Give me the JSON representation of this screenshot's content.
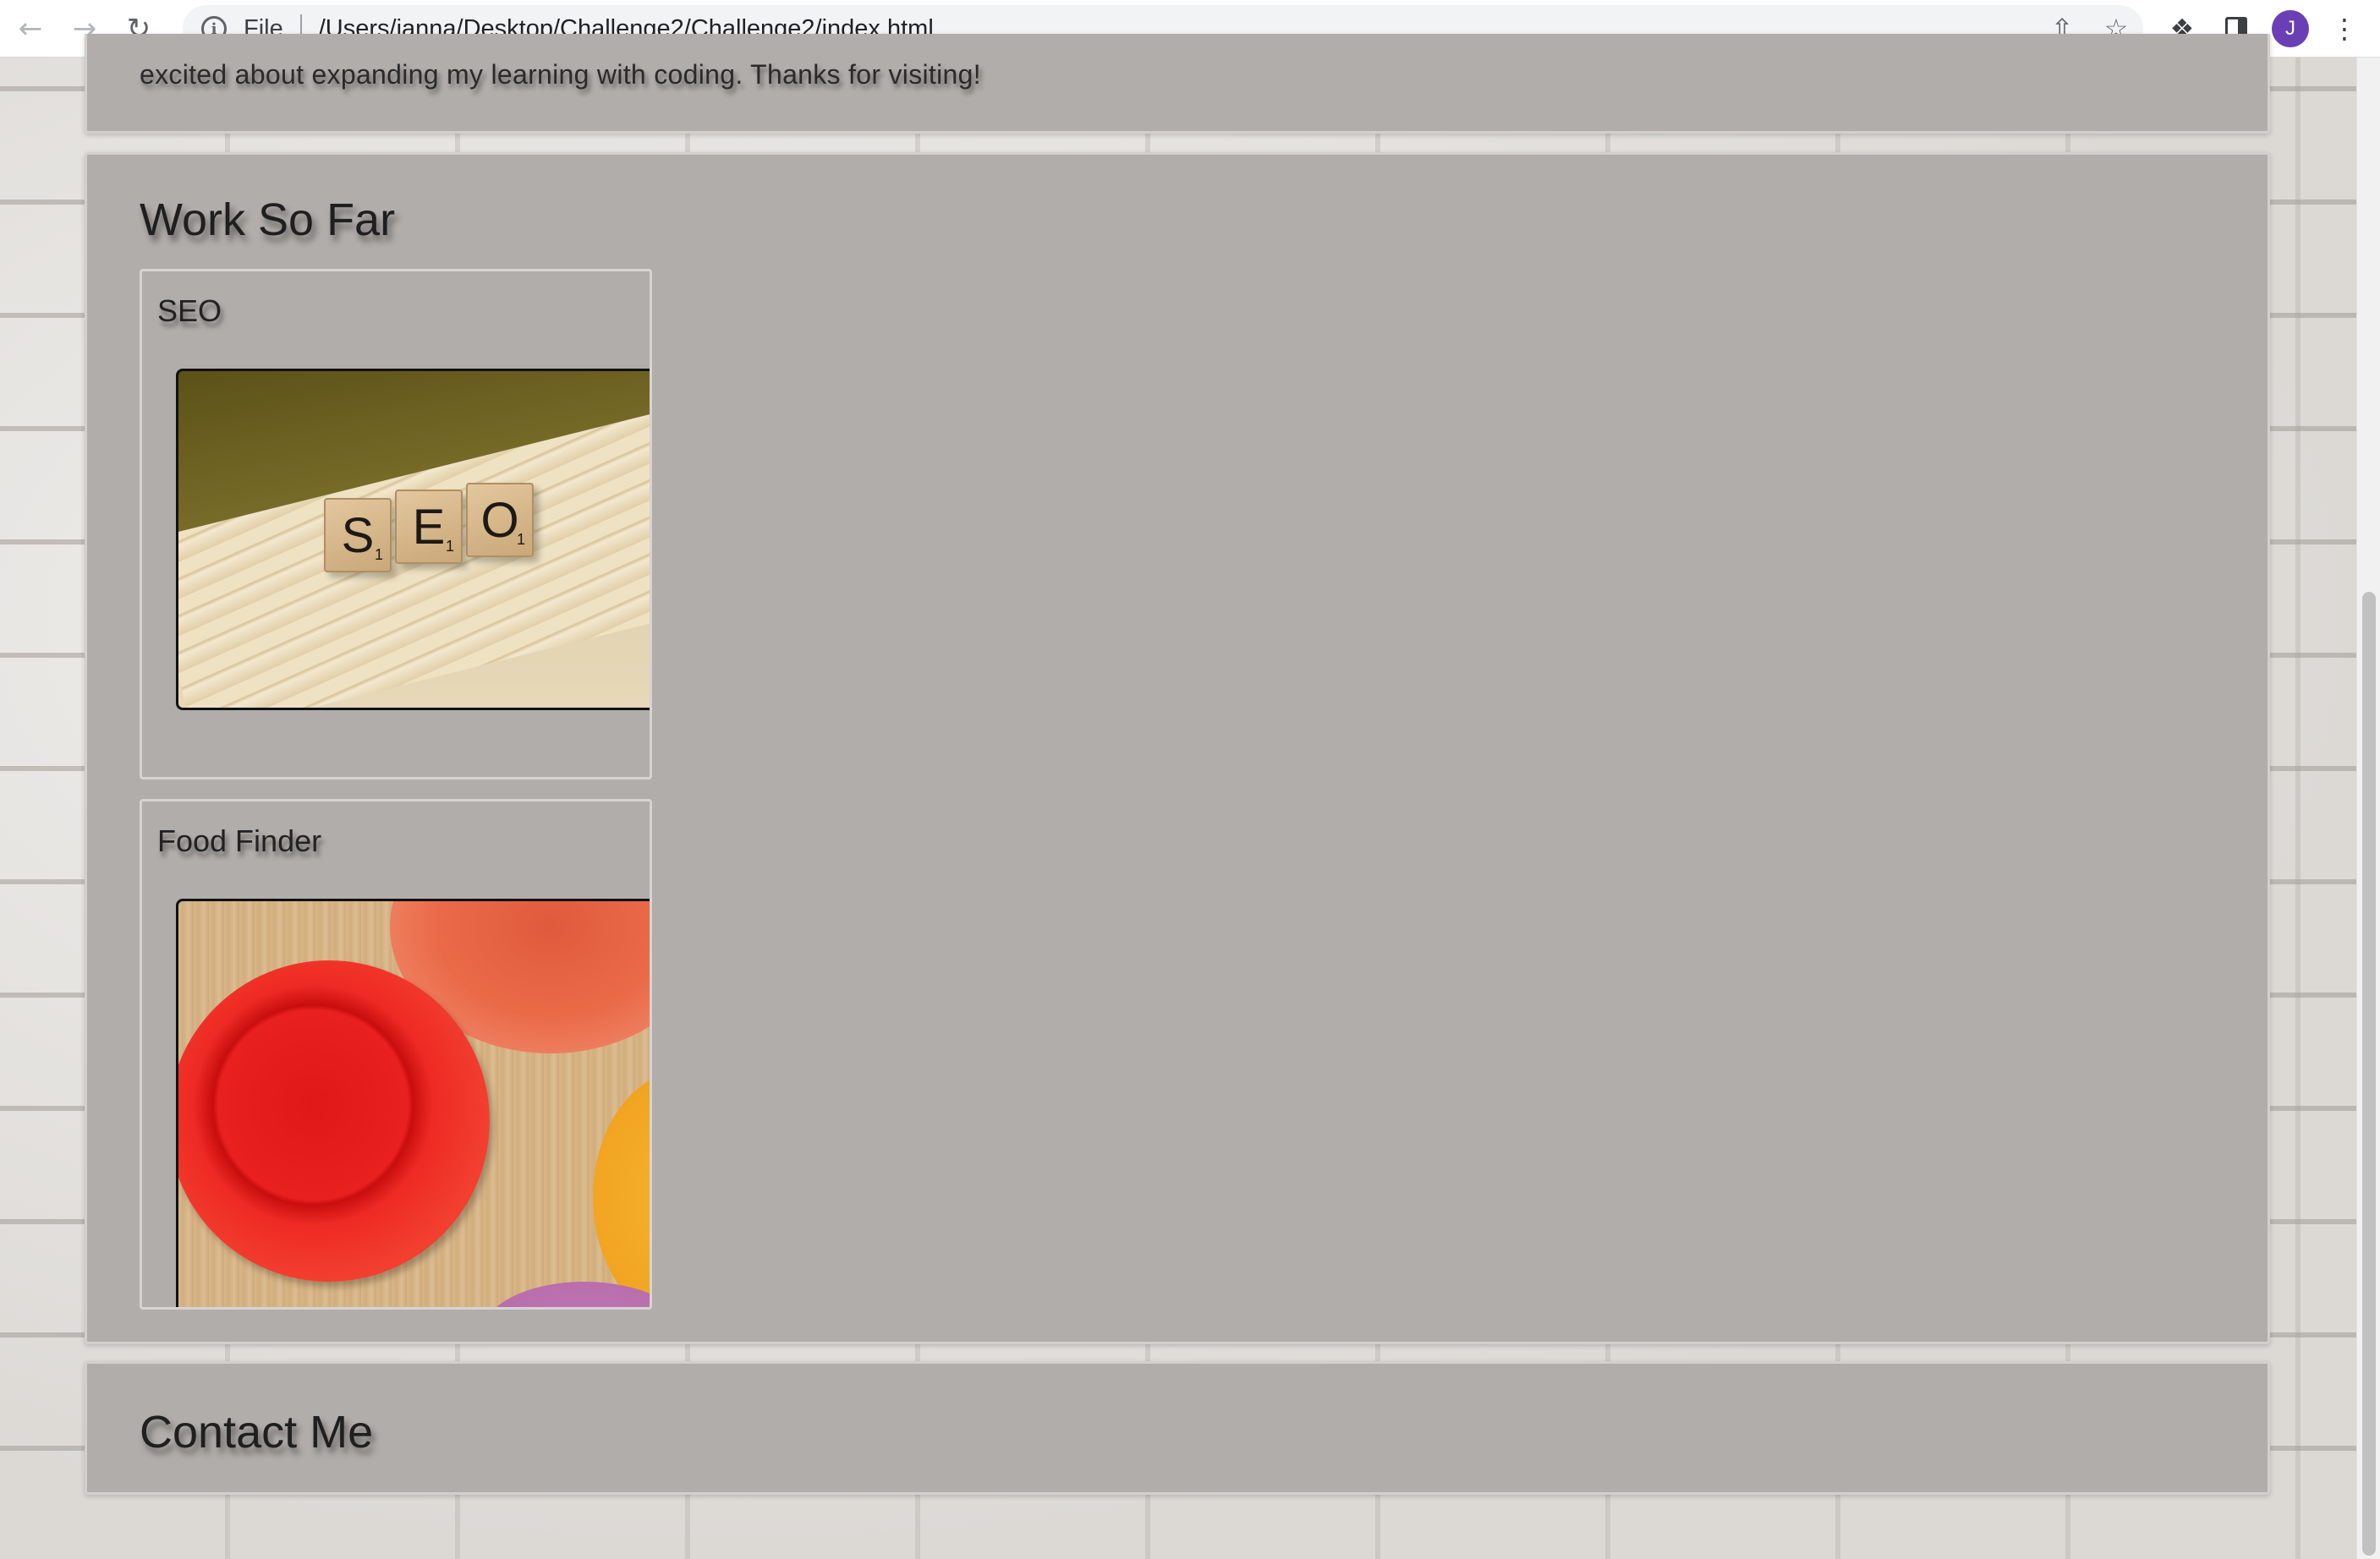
{
  "browser": {
    "scheme_label": "File",
    "url": "/Users/janna/Desktop/Challenge2/Challenge2/index.html",
    "profile_initial": "J",
    "profile_color": "#6a3fb5"
  },
  "about": {
    "text": "excited about expanding my learning with coding. Thanks for visiting!"
  },
  "work": {
    "title": "Work So Far",
    "projects": [
      {
        "title": "SEO",
        "image_tiles": [
          "S",
          "E",
          "O"
        ],
        "tile_points": [
          "1",
          "1",
          "1"
        ]
      },
      {
        "title": "Food Finder"
      }
    ]
  },
  "contact": {
    "title": "Contact Me"
  },
  "colors": {
    "section_bg": "#b1adaa",
    "section_border": "#d3d0cc"
  }
}
